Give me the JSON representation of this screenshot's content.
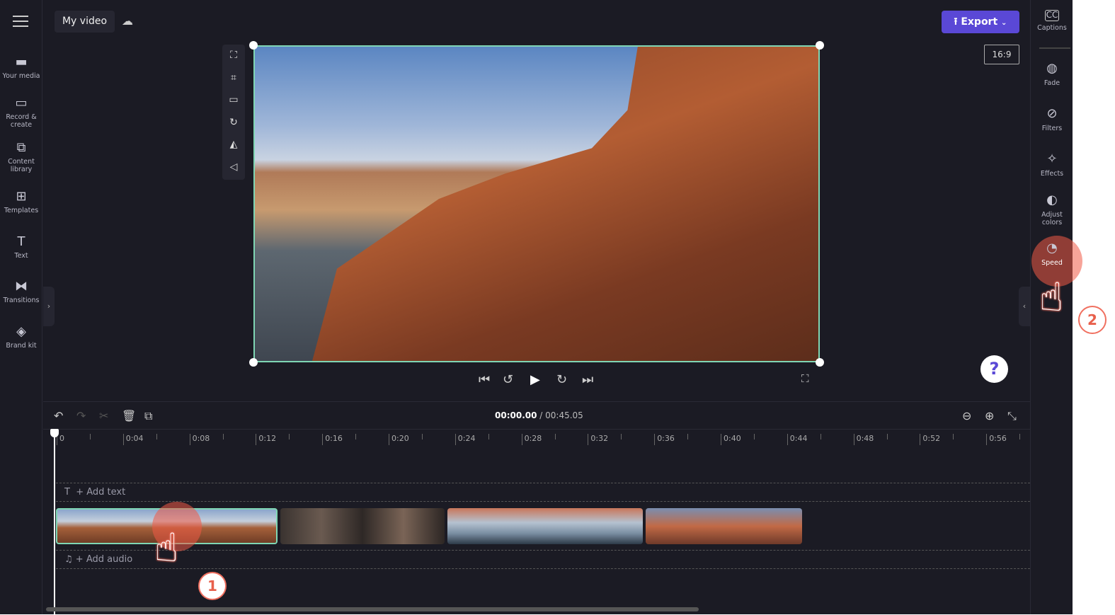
{
  "header": {
    "project_title": "My video",
    "export_label": "Export",
    "aspect_ratio": "16:9"
  },
  "left_nav": [
    {
      "label": "Your media",
      "icon": "folder-icon"
    },
    {
      "label": "Record & create",
      "icon": "camera-icon"
    },
    {
      "label": "Content library",
      "icon": "library-icon"
    },
    {
      "label": "Templates",
      "icon": "templates-icon"
    },
    {
      "label": "Text",
      "icon": "text-icon"
    },
    {
      "label": "Transitions",
      "icon": "transitions-icon"
    },
    {
      "label": "Brand kit",
      "icon": "brand-kit-icon"
    }
  ],
  "right_nav": [
    {
      "label": "Captions",
      "icon": "cc-icon"
    },
    {
      "label": "Fade",
      "icon": "fade-icon"
    },
    {
      "label": "Filters",
      "icon": "filters-icon"
    },
    {
      "label": "Effects",
      "icon": "magic-wand-icon"
    },
    {
      "label": "Adjust colors",
      "icon": "contrast-icon"
    },
    {
      "label": "Speed",
      "icon": "speedometer-icon"
    }
  ],
  "timeline": {
    "current_time": "00:00.00",
    "total_time": "/ 00:45.05",
    "ticks": [
      "0",
      "0:04",
      "0:08",
      "0:12",
      "0:16",
      "0:20",
      "0:24",
      "0:28",
      "0:32",
      "0:36",
      "0:40",
      "0:44",
      "0:48",
      "0:52",
      "0:56"
    ],
    "add_text": "+ Add text",
    "add_audio": "+ Add audio"
  },
  "help": "?",
  "steps": [
    "1",
    "2"
  ],
  "accent": "#5a48d6",
  "selection_color": "#7fd6b4",
  "annotation_color": "#f07060"
}
